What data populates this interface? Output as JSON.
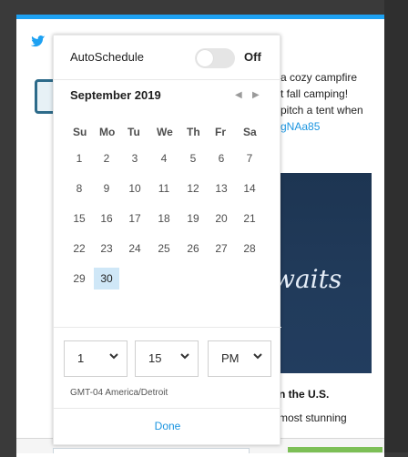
{
  "background": {
    "tweet_fragment": {
      "lines": [
        "a cozy campfire",
        "t fall camping!",
        "pitch a tent when",
        "gNAa85"
      ],
      "media_text": "waits",
      "card_title": "n the U.S.",
      "card_desc": "most stunning"
    }
  },
  "scheduler": {
    "auto_label": "AutoSchedule",
    "toggle_state": "Off",
    "month_label": "September 2019",
    "weekdays": [
      "Su",
      "Mo",
      "Tu",
      "We",
      "Th",
      "Fr",
      "Sa"
    ],
    "weeks": [
      [
        "1",
        "2",
        "3",
        "4",
        "5",
        "6",
        "7"
      ],
      [
        "8",
        "9",
        "10",
        "11",
        "12",
        "13",
        "14"
      ],
      [
        "15",
        "16",
        "17",
        "18",
        "19",
        "20",
        "21"
      ],
      [
        "22",
        "23",
        "24",
        "25",
        "26",
        "27",
        "28"
      ],
      [
        "29",
        "30"
      ]
    ],
    "selected_day": "30",
    "time": {
      "hour": "1",
      "minute": "15",
      "ampm": "PM"
    },
    "timezone": "GMT-04 America/Detroit",
    "done_label": "Done"
  },
  "colors": {
    "accent": "#1da1f2",
    "selected_day_bg": "#cfe7f7",
    "link": "#1b95e0"
  },
  "icons": {
    "brand": "twitter-icon",
    "prev": "prev-month-icon",
    "next": "next-month-icon",
    "dropdown": "chevron-down-icon"
  }
}
